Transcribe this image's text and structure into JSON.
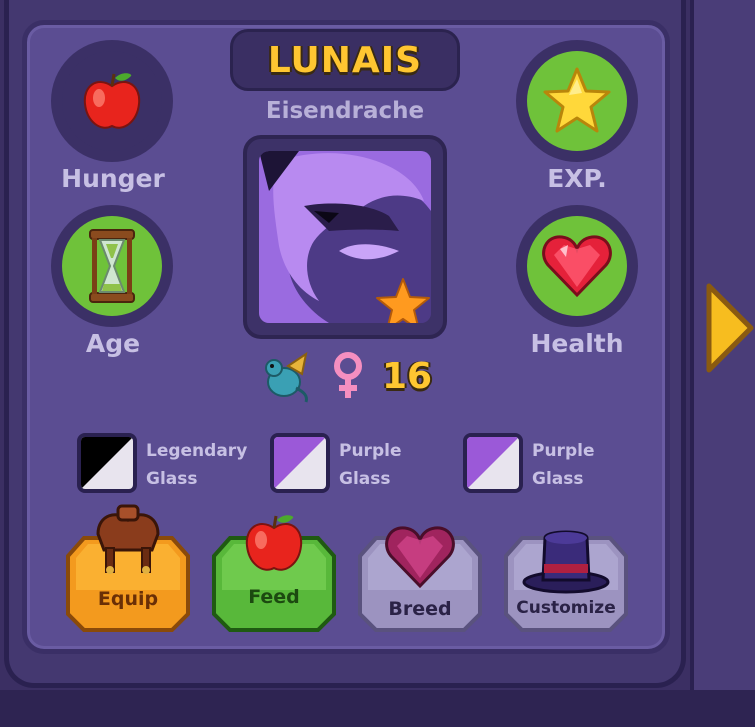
{
  "pet": {
    "name": "LUNAIS",
    "species": "Eisendrache",
    "level": "16",
    "gender_icon": "female-symbol-icon",
    "type_icon": "dragon-icon",
    "rarity_icon": "star-icon"
  },
  "stats": {
    "hunger": {
      "label": "Hunger",
      "icon": "apple-icon",
      "fill": "#3b3066"
    },
    "age": {
      "label": "Age",
      "icon": "hourglass-icon",
      "fill": "#6fc23a"
    },
    "exp": {
      "label": "EXP.",
      "icon": "star-icon",
      "fill": "#6fc23a"
    },
    "health": {
      "label": "Health",
      "icon": "heart-icon",
      "fill": "#6fc23a"
    }
  },
  "materials": [
    {
      "line1": "Legendary",
      "line2": "Glass",
      "color": "#000000"
    },
    {
      "line1": "Purple",
      "line2": "Glass",
      "color": "#9b59d8"
    },
    {
      "line1": "Purple",
      "line2": "Glass",
      "color": "#9b59d8"
    }
  ],
  "actions": {
    "equip": {
      "label": "Equip",
      "icon": "saddle-icon",
      "color": "#f39a1e"
    },
    "feed": {
      "label": "Feed",
      "icon": "apple-icon",
      "color": "#58b83a"
    },
    "breed": {
      "label": "Breed",
      "icon": "heart-gem-icon",
      "color": "#9c93c0"
    },
    "customize": {
      "label": "Customize",
      "icon": "top-hat-icon",
      "color": "#9c93c0"
    }
  },
  "navigation": {
    "next_icon": "chevron-right-icon"
  },
  "colors": {
    "accent_gold": "#ffc631",
    "panel": "#5b4d92",
    "green": "#6fc23a"
  }
}
